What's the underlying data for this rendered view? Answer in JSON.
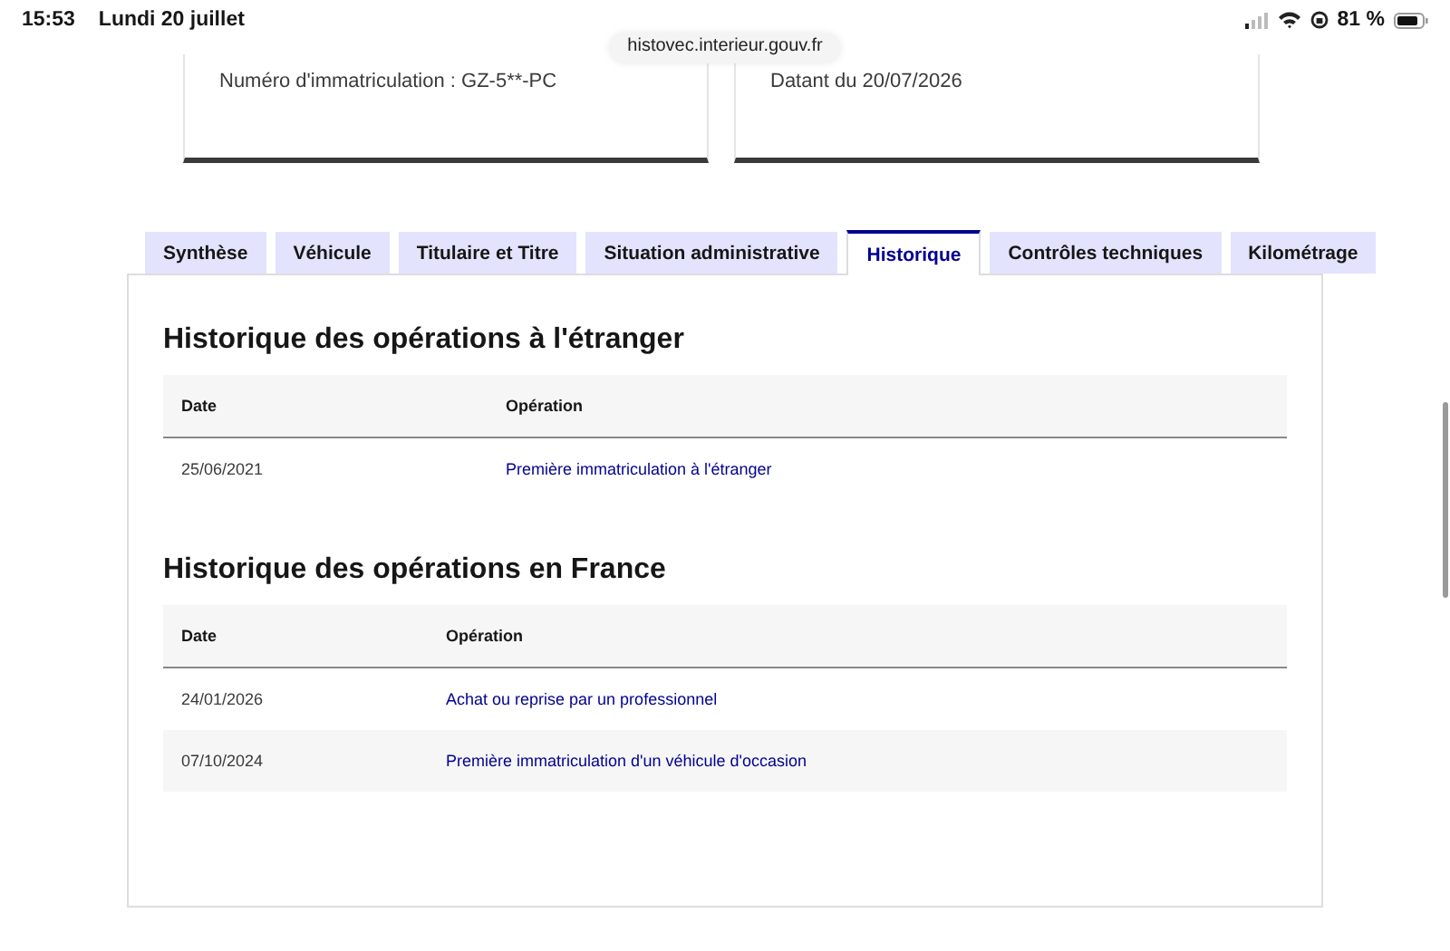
{
  "status_bar": {
    "time": "15:53",
    "date": "Lundi 20 juillet",
    "battery": "81 %"
  },
  "url": "histovec.interieur.gouv.fr",
  "cards": [
    {
      "text": "Numéro d'immatriculation : GZ-5**-PC"
    },
    {
      "text": "Datant du 20/07/2026"
    }
  ],
  "tabs": [
    {
      "label": "Synthèse",
      "selected": false
    },
    {
      "label": "Véhicule",
      "selected": false
    },
    {
      "label": "Titulaire et Titre",
      "selected": false
    },
    {
      "label": "Situation administrative",
      "selected": false
    },
    {
      "label": "Historique",
      "selected": true
    },
    {
      "label": "Contrôles techniques",
      "selected": false
    },
    {
      "label": "Kilométrage",
      "selected": false
    }
  ],
  "sections": [
    {
      "title": "Historique des opérations à l'étranger",
      "columns": [
        "Date",
        "Opération"
      ],
      "rows": [
        {
          "date": "25/06/2021",
          "operation": "Première immatriculation à l'étranger"
        }
      ]
    },
    {
      "title": "Historique des opérations en France",
      "columns": [
        "Date",
        "Opération"
      ],
      "rows": [
        {
          "date": "24/01/2026",
          "operation": "Achat ou reprise par un professionnel"
        },
        {
          "date": "07/10/2024",
          "operation": "Première immatriculation d'un véhicule d'occasion"
        }
      ]
    }
  ]
}
